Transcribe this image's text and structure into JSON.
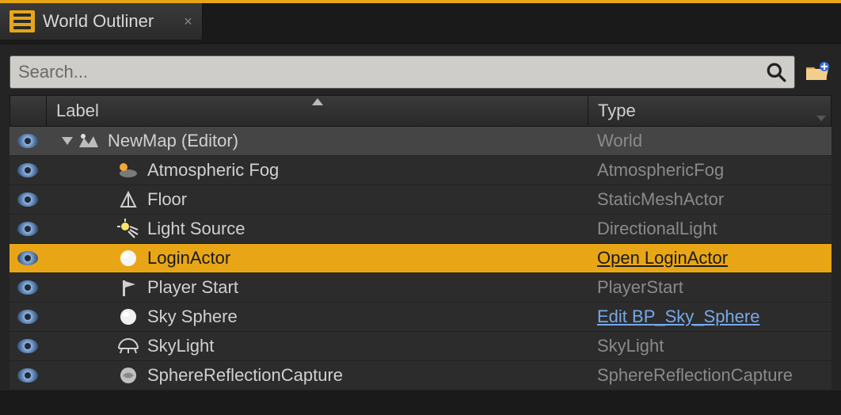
{
  "tab": {
    "title": "World Outliner"
  },
  "search": {
    "placeholder": "Search..."
  },
  "columns": {
    "label": "Label",
    "type": "Type"
  },
  "root": {
    "label": "NewMap (Editor)",
    "type": "World"
  },
  "items": [
    {
      "label": "Atmospheric Fog",
      "type": "AtmosphericFog"
    },
    {
      "label": "Floor",
      "type": "StaticMeshActor"
    },
    {
      "label": "Light Source",
      "type": "DirectionalLight"
    },
    {
      "label": "LoginActor",
      "type": "Open LoginActor"
    },
    {
      "label": "Player Start",
      "type": "PlayerStart"
    },
    {
      "label": "Sky Sphere",
      "type": "Edit BP_Sky_Sphere"
    },
    {
      "label": "SkyLight",
      "type": "SkyLight"
    },
    {
      "label": "SphereReflectionCapture",
      "type": "SphereReflectionCapture"
    }
  ]
}
